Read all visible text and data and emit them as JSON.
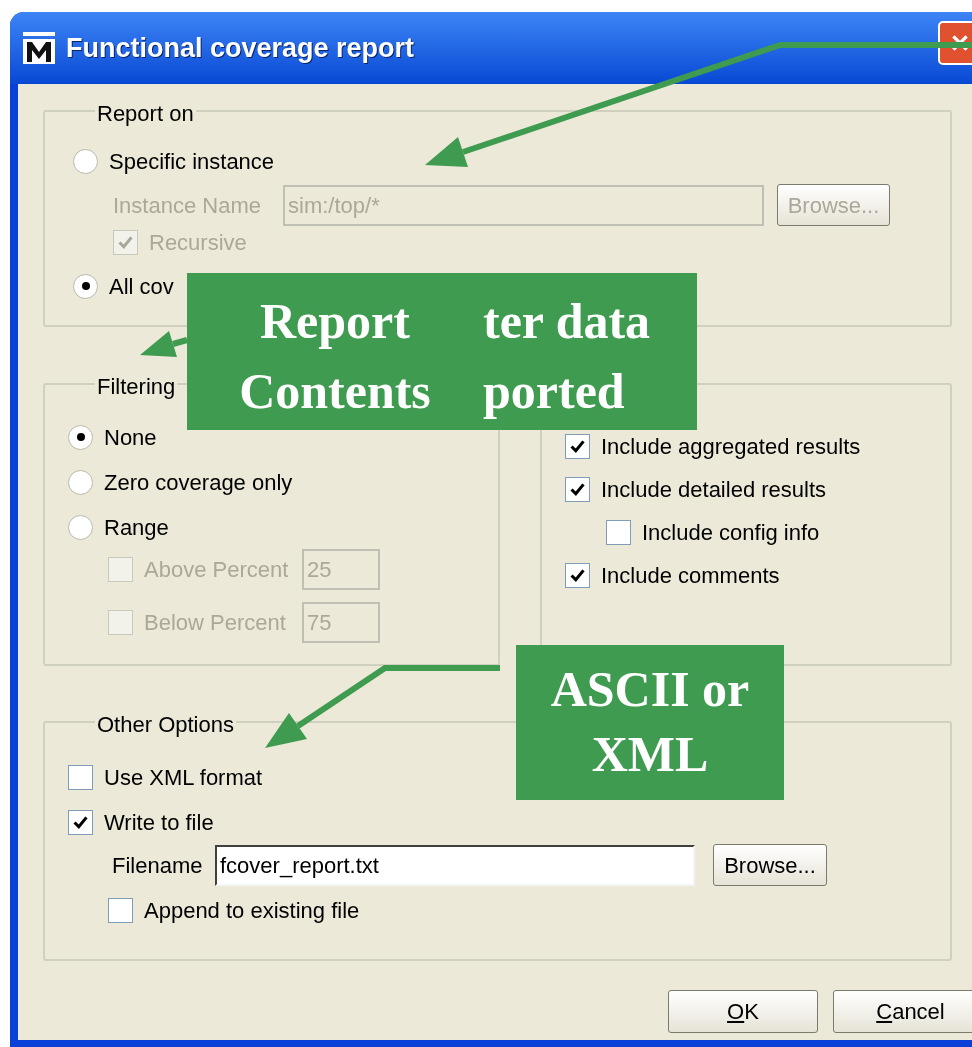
{
  "window": {
    "title": "Functional coverage report"
  },
  "report_on": {
    "legend": "Report on",
    "options": [
      {
        "label": "Specific instance",
        "selected": false
      },
      {
        "label": "All cov",
        "selected": true
      }
    ],
    "instance_name": {
      "label": "Instance Name",
      "value": "sim:/top/*",
      "disabled": true
    },
    "browse_button": {
      "label": "Browse...",
      "disabled": true
    },
    "recursive": {
      "label": "Recursive",
      "checked": true,
      "disabled": true
    }
  },
  "filtering": {
    "legend": "Filtering",
    "options": [
      {
        "label": "None",
        "selected": true
      },
      {
        "label": "Zero coverage only",
        "selected": false
      },
      {
        "label": "Range",
        "selected": false
      }
    ],
    "thresholds": [
      {
        "label": "Above Percent",
        "checked": false,
        "disabled": true,
        "value": "25"
      },
      {
        "label": "Below Percent",
        "checked": false,
        "disabled": true,
        "value": "75"
      }
    ]
  },
  "include_options": [
    {
      "label": "Include aggregated results",
      "checked": true
    },
    {
      "label": "Include detailed results",
      "checked": true,
      "children": [
        {
          "label": "Include config info",
          "checked": false
        }
      ]
    },
    {
      "label": "Include comments",
      "checked": true
    }
  ],
  "other_options": {
    "legend": "Other Options",
    "use_xml": {
      "label": "Use XML format",
      "checked": false
    },
    "write_to_file": {
      "label": "Write to file",
      "checked": true
    },
    "filename": {
      "label": "Filename",
      "value": "fcover_report.txt"
    },
    "browse_button": {
      "label": "Browse..."
    },
    "append": {
      "label": "Append to existing file",
      "checked": false
    }
  },
  "buttons": [
    {
      "label": "OK"
    },
    {
      "label": "Cancel"
    }
  ],
  "callouts": [
    {
      "lines": [
        "Report",
        "ter data",
        "Contents",
        "ported"
      ]
    },
    {
      "text": "ASCII or XML"
    }
  ]
}
